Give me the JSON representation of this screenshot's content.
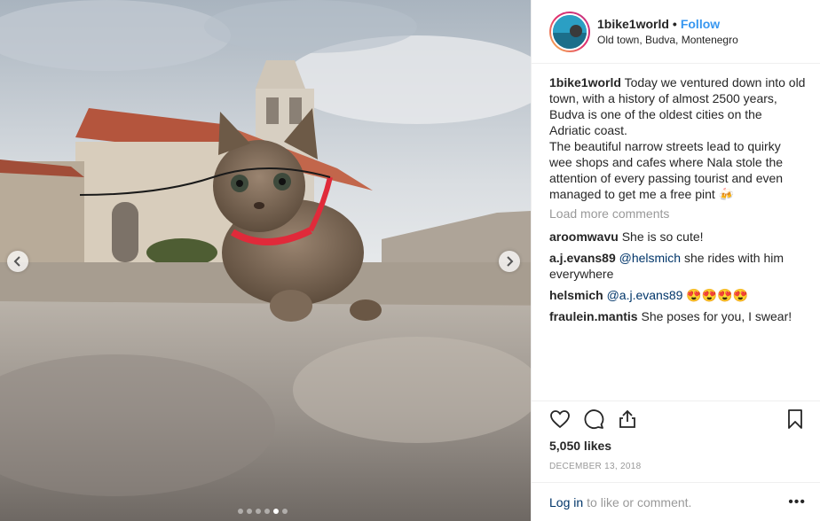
{
  "header": {
    "username": "1bike1world",
    "separator": "•",
    "follow_label": "Follow",
    "location": "Old town, Budva, Montenegro"
  },
  "caption": {
    "username": "1bike1world",
    "line1": "Today we ventured down into old town, with a history of almost 2500 years, Budva is one of the oldest cities on the Adriatic coast.",
    "line2": "The beautiful narrow streets lead to quirky wee shops and cafes where Nala stole the attention of every passing tourist and even managed to get me a free pint 🍻"
  },
  "load_more": "Load more comments",
  "comments": [
    {
      "username": "aroomwavu",
      "mention": "",
      "text": "She is so cute!"
    },
    {
      "username": "a.j.evans89",
      "mention": "@helsmich",
      "text": "she rides with him everywhere"
    },
    {
      "username": "helsmich",
      "mention": "@a.j.evans89",
      "text": "😍😍😍😍"
    },
    {
      "username": "fraulein.mantis",
      "mention": "",
      "text": "She poses for you, I swear!"
    }
  ],
  "likes": "5,050 likes",
  "date": "DECEMBER 13, 2018",
  "footer": {
    "login_link": "Log in",
    "login_rest": "to like or comment.",
    "more": "•••"
  },
  "media": {
    "alt": "kitten on stone pavement in old town",
    "carousel_total": 6,
    "carousel_active": 5
  },
  "icons": {
    "like": "heart-icon",
    "comment": "comment-icon",
    "share": "share-icon",
    "save": "bookmark-icon",
    "prev": "chevron-left-icon",
    "next": "chevron-right-icon"
  },
  "colors": {
    "link": "#3897f0",
    "mention": "#003569",
    "muted": "#999999",
    "text": "#262626"
  }
}
